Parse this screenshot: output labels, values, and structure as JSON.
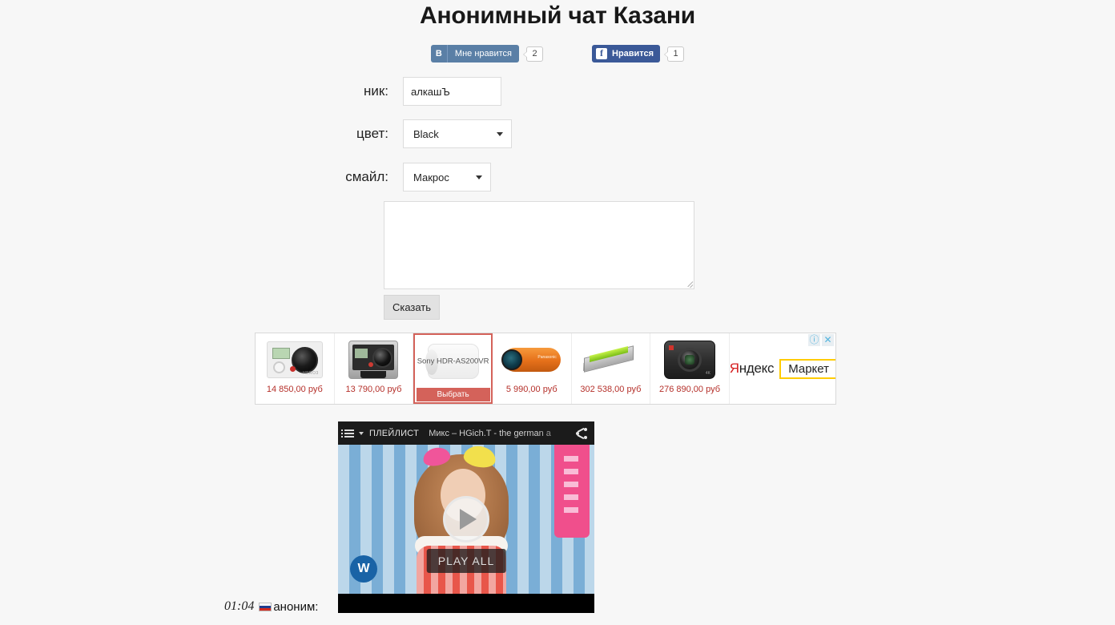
{
  "page": {
    "title": "Анонимный чат Казани",
    "background_color": "#f7f7f7"
  },
  "social": {
    "vk": {
      "icon": "vk-icon",
      "icon_letter": "В",
      "label": "Мне нравится",
      "count": "2",
      "color": "#5a7fa6"
    },
    "facebook": {
      "icon": "facebook-icon",
      "icon_letter": "f",
      "label": "Нравится",
      "count": "1",
      "color": "#3b5998"
    }
  },
  "form": {
    "nick": {
      "label": "ник:",
      "value": "алкашЪ",
      "placeholder": ""
    },
    "color": {
      "label": "цвет:",
      "value": "Black"
    },
    "smile": {
      "label": "смайл:",
      "value": "Макрос"
    },
    "message": {
      "value": "",
      "placeholder": ""
    },
    "submit_label": "Сказать"
  },
  "ad": {
    "brand_ya": "Я",
    "brand_ndex": "ндекс",
    "brand_market": "Маркет",
    "info_icon": "ⓘ",
    "close_icon": "✕",
    "pick_label": "Выбрать",
    "sony_label": "Sony HDR-AS200VR",
    "items": [
      {
        "price": "14 850,00 руб",
        "thumb": "gopro-hero3-camera"
      },
      {
        "price": "13 790,00 руб",
        "thumb": "gopro-hero4-camera"
      },
      {
        "price": "",
        "thumb": "sony-action-camera",
        "highlighted": true
      },
      {
        "price": "5 990,00 руб",
        "thumb": "panasonic-orange-camera"
      },
      {
        "price": "302 538,00 руб",
        "thumb": "graphics-card"
      },
      {
        "price": "276 890,00 руб",
        "thumb": "blackmagic-cinema-camera"
      }
    ]
  },
  "player": {
    "playlist_label": "ПЛЕЙЛИСТ",
    "video_title": "Микс – HGich.T - the german a",
    "play_all_label": "PLAY ALL",
    "watermark": "W",
    "share_icon": "share-icon"
  },
  "chat": {
    "messages": [
      {
        "time": "01:04",
        "flag": "russia-flag",
        "nick": "аноним:",
        "text": ""
      }
    ]
  }
}
